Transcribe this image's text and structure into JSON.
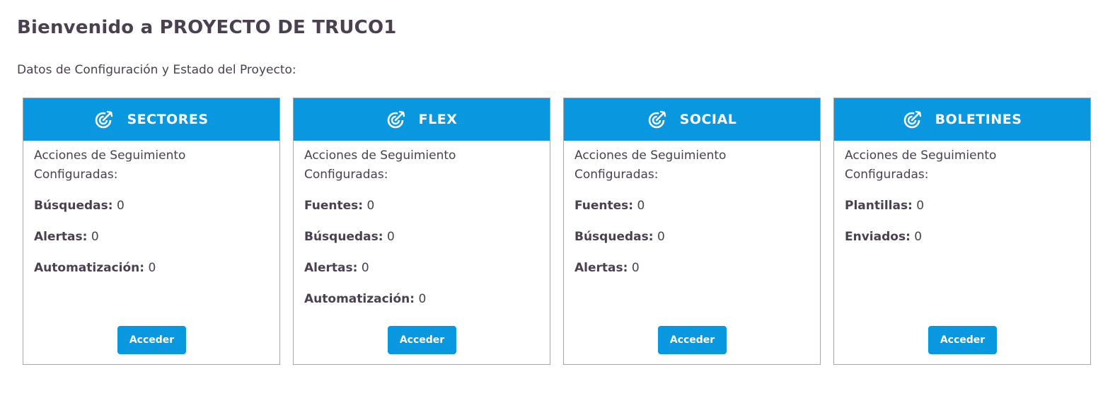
{
  "page": {
    "title": "Bienvenido a PROYECTO DE TRUCO1",
    "subtitle": "Datos de Configuración y Estado del Proyecto:"
  },
  "colors": {
    "accent": "#0998e0",
    "text": "#4a4050",
    "border": "#a7a7a7"
  },
  "cards": [
    {
      "title": "SECTORES",
      "icon": "target-arrow-icon",
      "description": "Acciones de Seguimiento Configuradas:",
      "stats": [
        {
          "label": "Búsquedas:",
          "value": "0"
        },
        {
          "label": "Alertas:",
          "value": "0"
        },
        {
          "label": "Automatización:",
          "value": "0"
        }
      ],
      "button_label": "Acceder"
    },
    {
      "title": "FLEX",
      "icon": "target-arrow-icon",
      "description": "Acciones de Seguimiento Configuradas:",
      "stats": [
        {
          "label": "Fuentes:",
          "value": "0"
        },
        {
          "label": "Búsquedas:",
          "value": "0"
        },
        {
          "label": "Alertas:",
          "value": "0"
        },
        {
          "label": "Automatización:",
          "value": "0"
        }
      ],
      "button_label": "Acceder"
    },
    {
      "title": "SOCIAL",
      "icon": "target-arrow-icon",
      "description": "Acciones de Seguimiento Configuradas:",
      "stats": [
        {
          "label": "Fuentes:",
          "value": "0"
        },
        {
          "label": "Búsquedas:",
          "value": "0"
        },
        {
          "label": "Alertas:",
          "value": "0"
        }
      ],
      "button_label": "Acceder"
    },
    {
      "title": "BOLETINES",
      "icon": "target-arrow-icon",
      "description": "Acciones de Seguimiento Configuradas:",
      "stats": [
        {
          "label": "Plantillas:",
          "value": "0"
        },
        {
          "label": "Enviados:",
          "value": "0"
        }
      ],
      "button_label": "Acceder"
    }
  ]
}
